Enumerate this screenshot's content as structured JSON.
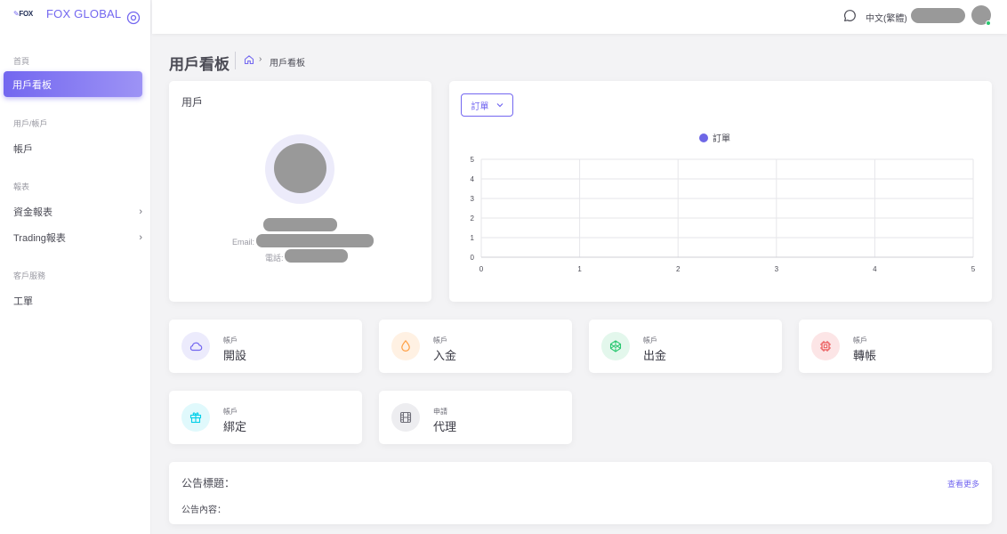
{
  "brand": {
    "logo_text": "FOX",
    "name": "FOX GLOBAL"
  },
  "sidebar": {
    "sections": [
      {
        "label": "首頁",
        "items": [
          {
            "label": "用戶看板",
            "active": true,
            "has_arrow": false
          }
        ]
      },
      {
        "label": "用戶/帳戶",
        "items": [
          {
            "label": "帳戶",
            "active": false,
            "has_arrow": false
          }
        ]
      },
      {
        "label": "報表",
        "items": [
          {
            "label": "資金報表",
            "active": false,
            "has_arrow": true
          },
          {
            "label": "Trading報表",
            "active": false,
            "has_arrow": true
          }
        ]
      },
      {
        "label": "客戶服務",
        "items": [
          {
            "label": "工單",
            "active": false,
            "has_arrow": false
          }
        ]
      }
    ]
  },
  "header": {
    "language": "中文(繁體)",
    "chat_icon": "chat-icon",
    "avatar_online": true
  },
  "breadcrumb": {
    "title": "用戶看板",
    "current": "用戶看板"
  },
  "user_card": {
    "title": "用戶",
    "email_label": "Email:",
    "phone_label": "電話:"
  },
  "chart_card": {
    "select_label": "訂單",
    "chart_data": {
      "type": "line",
      "series": [
        {
          "name": "訂單",
          "values": []
        }
      ],
      "x": [
        0,
        1,
        2,
        3,
        4,
        5
      ],
      "y_ticks": [
        0,
        1,
        2,
        3,
        4,
        5
      ],
      "xlim": [
        0,
        5
      ],
      "ylim": [
        0,
        5
      ],
      "grid": true,
      "legend": "top-center",
      "series_color": "#6e67e6"
    }
  },
  "stats": [
    {
      "sub": "帳戶",
      "main": "開設",
      "icon": "cloud-icon",
      "color": "#7367f0",
      "bg": "#ecebfc"
    },
    {
      "sub": "帳戶",
      "main": "入金",
      "icon": "droplet-icon",
      "color": "#ff9f43",
      "bg": "#fff1e3"
    },
    {
      "sub": "帳戶",
      "main": "出金",
      "icon": "codepen-icon",
      "color": "#28c76f",
      "bg": "#e3f7ec"
    },
    {
      "sub": "帳戶",
      "main": "轉帳",
      "icon": "cpu-icon",
      "color": "#ea5455",
      "bg": "#fce5e6"
    },
    {
      "sub": "帳戶",
      "main": "綁定",
      "icon": "gift-icon",
      "color": "#00cfe8",
      "bg": "#e0f9fc"
    },
    {
      "sub": "申請",
      "main": "代理",
      "icon": "film-icon",
      "color": "#6e6e78",
      "bg": "#ededf0"
    }
  ],
  "notice": {
    "title": "公告標題：",
    "more": "查看更多",
    "content": "公告內容："
  },
  "colors": {
    "accent": "#7367f0",
    "online": "#28c76f"
  }
}
